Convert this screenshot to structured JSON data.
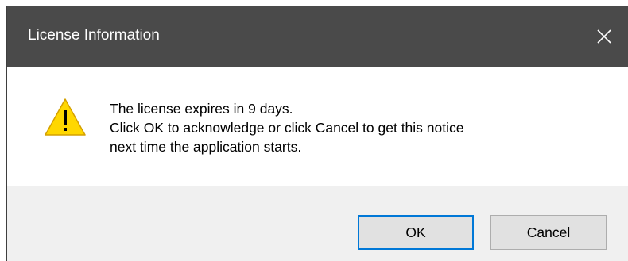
{
  "window": {
    "title": "License Information",
    "close_icon": "close-icon"
  },
  "message": {
    "icon": "warning-icon",
    "lines": [
      "The license expires in 9 days.",
      "Click OK to acknowledge or click Cancel to get this notice",
      "next time the application starts."
    ]
  },
  "buttons": {
    "ok_label": "OK",
    "cancel_label": "Cancel"
  },
  "colors": {
    "titlebar": "#4a4a4a",
    "footer": "#f0f0f0",
    "default_button_border": "#0078d7",
    "warning_fill": "#ffd700"
  }
}
